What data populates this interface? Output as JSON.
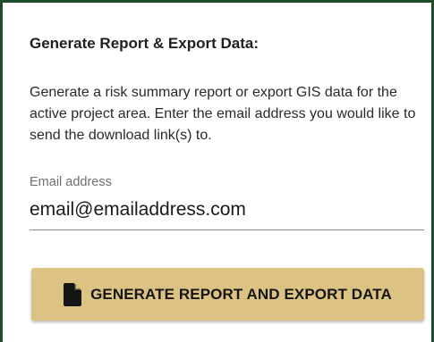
{
  "panel": {
    "title": "Generate Report & Export Data:",
    "description": "Generate a risk summary report or export GIS data for the active project area. Enter the email address you would like to send the download link(s) to."
  },
  "email_field": {
    "label": "Email address",
    "value": "email@emailaddress.com"
  },
  "generate_button": {
    "label": "GENERATE REPORT AND EXPORT DATA",
    "icon": "document-icon"
  },
  "colors": {
    "border": "#1e4d2b",
    "button_background": "#dcc283"
  }
}
